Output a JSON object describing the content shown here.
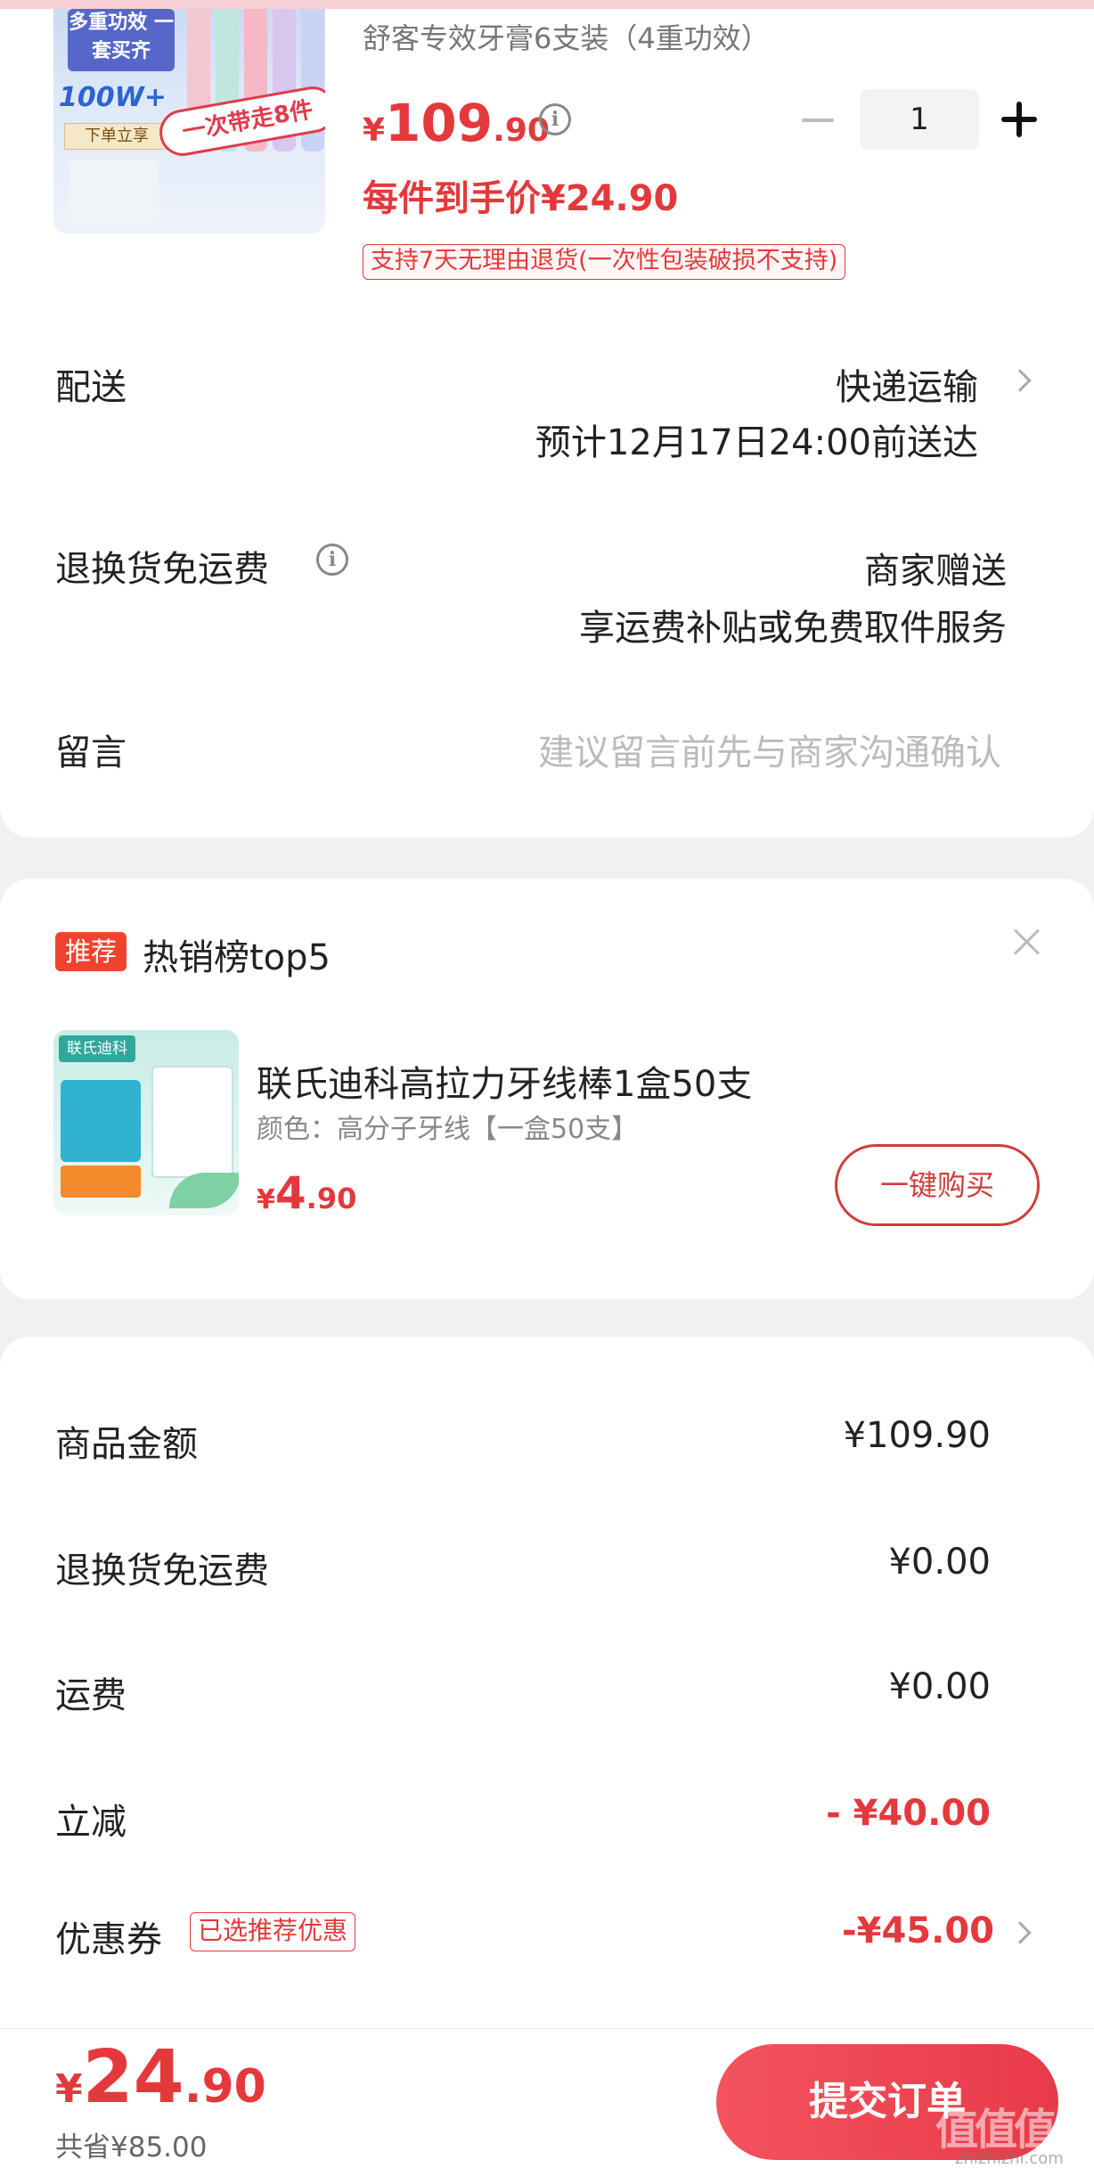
{
  "product": {
    "subtitle": "舒客专效牙膏6支装（4重功效）",
    "image_texts": {
      "feature": "多重功效 一套买齐",
      "sales": "100W+",
      "buy_hint": "下单立享",
      "ribbon": "一次带走8件"
    },
    "price_currency": "¥",
    "price_int": "109",
    "price_dec": ".90",
    "quantity": "1",
    "per_item_price": "每件到手价¥24.90",
    "return_policy": "支持7天无理由退货(一次性包装破损不支持)"
  },
  "delivery": {
    "label": "配送",
    "method": "快递运输",
    "eta": "预计12月17日24:00前送达"
  },
  "return_shipping": {
    "label": "退换货免运费",
    "value": "商家赠送",
    "desc": "享运费补贴或免费取件服务"
  },
  "message": {
    "label": "留言",
    "placeholder": "建议留言前先与商家沟通确认"
  },
  "recommend": {
    "badge": "推荐",
    "title": "热销榜top5",
    "image_brand": "联氏迪科",
    "item_name": "联氏迪科高拉力牙线棒1盒50支",
    "item_spec": "颜色：高分子牙线【一盒50支】",
    "price_currency": "¥",
    "price_int": "4",
    "price_dec": ".90",
    "buy_label": "一键购买"
  },
  "summary": {
    "rows": [
      {
        "label": "商品金额",
        "value": "¥109.90"
      },
      {
        "label": "退换货免运费",
        "value": "¥0.00"
      },
      {
        "label": "运费",
        "value": "¥0.00"
      },
      {
        "label": "立减",
        "value": "- ¥40.00"
      },
      {
        "label": "优惠券",
        "value": "-¥45.00"
      }
    ],
    "coupon_badge": "已选推荐优惠"
  },
  "footer": {
    "total_currency": "¥",
    "total_int": "24",
    "total_dec": ".90",
    "saved": "共省¥85.00",
    "submit_label": "提交订单",
    "watermark": "值值值",
    "watermark_sub": "zhizhizhi.com"
  },
  "colors": {
    "accent": "#e4393c",
    "submit_gradient_start": "#f4535c",
    "submit_gradient_end": "#e83a4a",
    "recommend_badge": "#f0432e"
  }
}
